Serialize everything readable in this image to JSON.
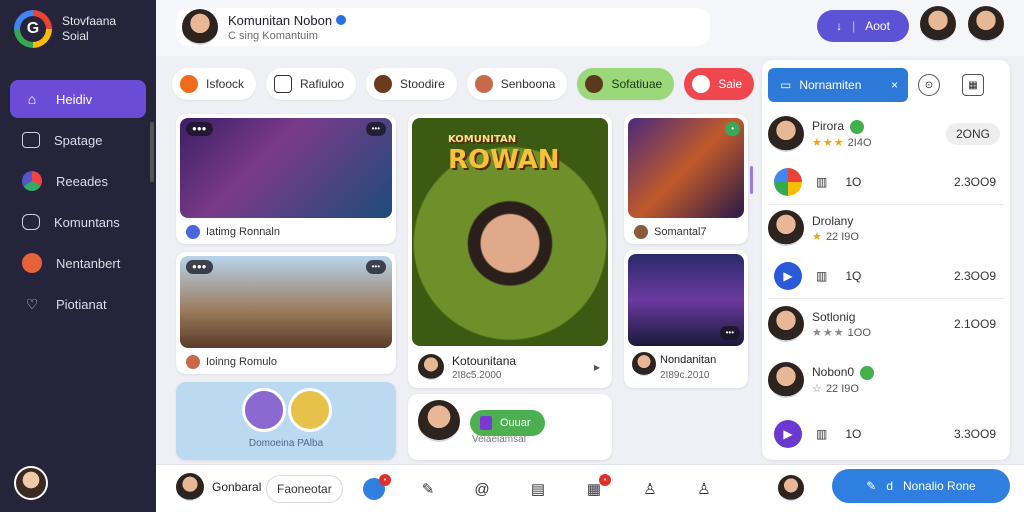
{
  "app": {
    "brand_line1": "Stovfaana",
    "brand_line2": "Soial",
    "logo_letter": "G"
  },
  "sidebar": {
    "items": [
      {
        "label": "Heidiv",
        "icon": "home-icon"
      },
      {
        "label": "Spatage",
        "icon": "inbox-icon"
      },
      {
        "label": "Reeades",
        "icon": "palette-icon"
      },
      {
        "label": "Komuntans",
        "icon": "folder-icon"
      },
      {
        "label": "Nentanbert",
        "icon": "face-icon"
      },
      {
        "label": "Piotianat",
        "icon": "heart-icon"
      }
    ]
  },
  "header": {
    "title": "Komunitan Nobon",
    "subtitle": "C sing Komantuim",
    "post_label": "Aoot",
    "post_icon": "↓"
  },
  "chips": [
    {
      "label": "Isfoock"
    },
    {
      "label": "Rafiuloo"
    },
    {
      "label": "Stoodire"
    },
    {
      "label": "Senboona"
    },
    {
      "label": "Sofatiuae"
    },
    {
      "label": "Saie"
    }
  ],
  "cards": {
    "party": {
      "label": "Iatimg Ronnaln"
    },
    "group": {
      "label": "Ioinng Romulo"
    },
    "hero": {
      "title": "ROWAN",
      "subtitle": "KOMUNITAN",
      "caption": "Kotounitana",
      "meta": "2I8c5.2000"
    },
    "game": {
      "label": "Somantal7"
    },
    "night": {
      "caption": "Nondanitan",
      "meta": "2I89c.2010"
    },
    "blue": {
      "label": "Domoeina PAlba"
    },
    "bottom": {
      "pill": "Ouuar",
      "caption": "Veiaelamsal"
    }
  },
  "panel": {
    "title": "Nornamiten",
    "title_action": "×",
    "rows": [
      {
        "name": "Pirora",
        "stars": "★★★",
        "score": "2I4O",
        "value": "2ONG",
        "green": "On"
      },
      {
        "value_a": "1O",
        "value": "2.3OO9"
      },
      {
        "name": "Drolany",
        "stars": "★",
        "score": "22 I9O"
      },
      {
        "value_a": "1Q",
        "value": "2.3OO9"
      },
      {
        "name": "Sotlonig",
        "stars": "★★★",
        "score": "1OO",
        "value": "2.1OO9"
      },
      {
        "name": "Nobon0",
        "stars": "☆",
        "score": "22 I9O",
        "green": "On"
      },
      {
        "value_a": "1O",
        "value": "3.3OO9"
      }
    ]
  },
  "bottombar": {
    "user": "Gonbaral",
    "chip": "Faoneotar",
    "cta": "Nonalio Rone",
    "cta_icon": "d"
  },
  "colors": {
    "sidebar_bg": "#25243a",
    "accent_purple": "#6a4cd6",
    "accent_blue": "#2d7ad8",
    "green": "#4caf50",
    "red": "#f0474e"
  }
}
